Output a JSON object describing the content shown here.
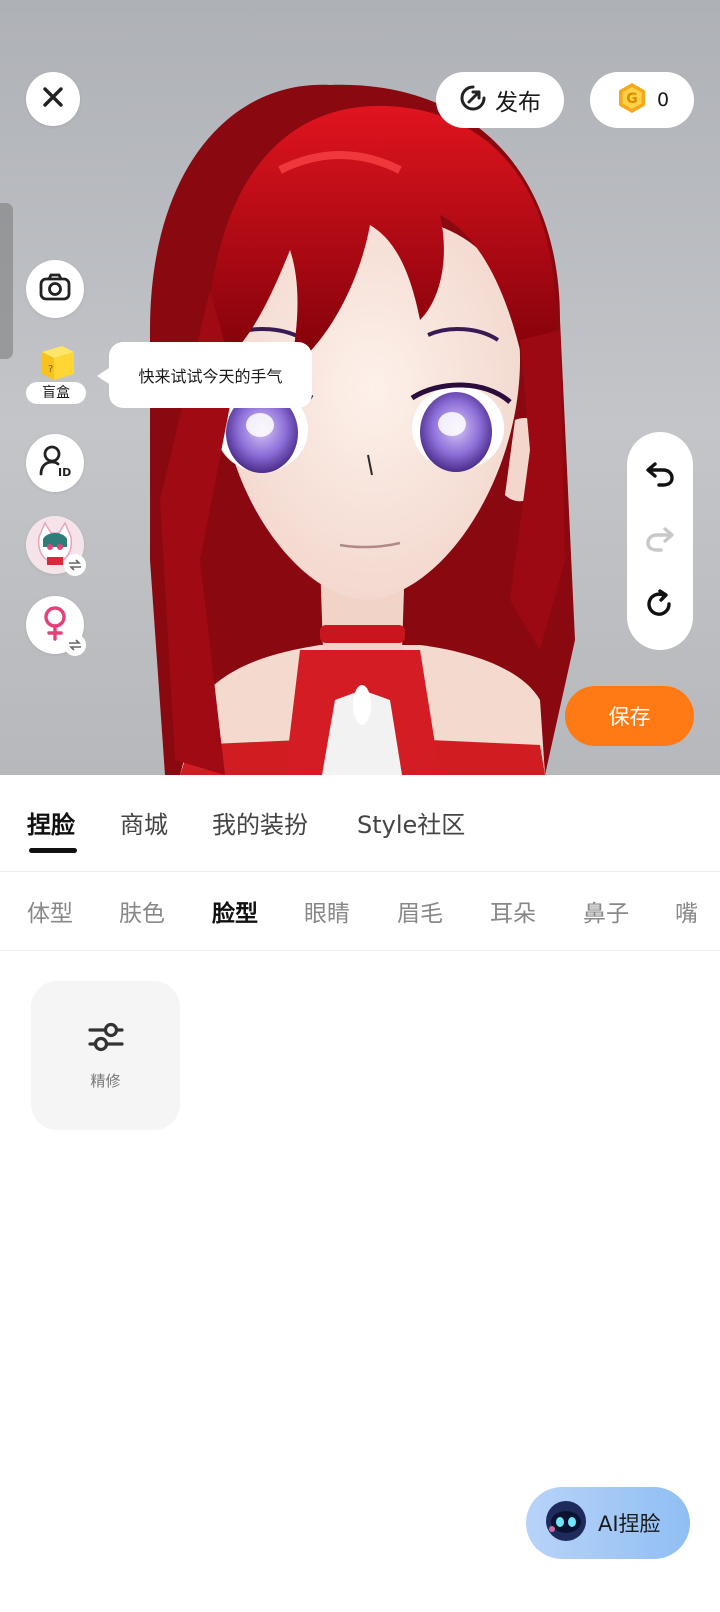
{
  "header": {
    "close_icon": "close-icon",
    "publish_label": "发布",
    "publish_icon": "publish-icon",
    "coin_icon": "coin-icon",
    "coin_count": "0"
  },
  "left_toolbar": {
    "camera_icon": "camera-icon",
    "blindbox_label": "盲盒",
    "tooltip_text": "快来试试今天的手气",
    "id_icon": "user-id-icon",
    "avatar_switch_icon": "swap-icon",
    "gender_icon": "female-icon"
  },
  "history": {
    "undo_icon": "undo-icon",
    "redo_icon": "redo-icon",
    "reset_icon": "reset-icon"
  },
  "save_label": "保存",
  "main_tabs": [
    {
      "label": "捏脸",
      "active": true
    },
    {
      "label": "商城",
      "active": false
    },
    {
      "label": "我的装扮",
      "active": false
    },
    {
      "label": "Style社区",
      "active": false
    }
  ],
  "sub_tabs": [
    {
      "label": "体型",
      "active": false
    },
    {
      "label": "肤色",
      "active": false
    },
    {
      "label": "脸型",
      "active": true
    },
    {
      "label": "眼睛",
      "active": false
    },
    {
      "label": "眉毛",
      "active": false
    },
    {
      "label": "耳朵",
      "active": false
    },
    {
      "label": "鼻子",
      "active": false
    },
    {
      "label": "嘴",
      "active": false
    }
  ],
  "tools": [
    {
      "label": "精修",
      "icon": "sliders-icon"
    }
  ],
  "ai_button": {
    "label": "AI捏脸",
    "icon": "robot-icon"
  },
  "colors": {
    "accent": "#ff7a14",
    "hair": "#c0111a",
    "eyes": "#8b6fd6",
    "ai_button": "#9cc5f6"
  }
}
